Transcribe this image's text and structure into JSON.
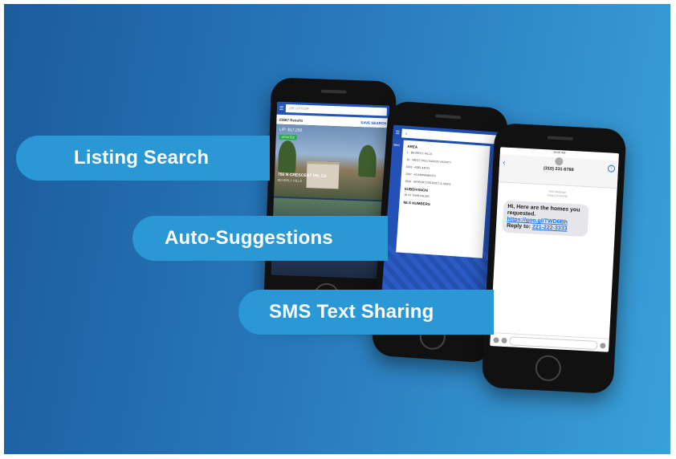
{
  "labels": {
    "listing_search": "Listing Search",
    "auto_suggestions": "Auto-Suggestions",
    "sms_text_sharing": "SMS Text Sharing"
  },
  "phone1": {
    "search_placeholder": "ZIP, CITY/ZIP",
    "results": "23687 Results",
    "save": "SAVE SEARCH",
    "price": "L/P: $17,250",
    "tag": "UPDATED",
    "address": "755 N CRESCENT DR, CA",
    "city": "BEVERLY HILLS"
  },
  "phone2": {
    "search_value": "1",
    "area_heading": "AREA",
    "area_items": [
      "1 - BEVERLY HILLS",
      "10 - WEST HOLLYWOOD VICINITY",
      "1003 - ADELANTO",
      "1007 - ACAMPAMENTO",
      "1009 - AIRPORT DISTRICT & OAKS"
    ],
    "subdivision_heading": "SUBDIVISION",
    "subdivision_items": [
      "1E AT TWIN PALMS"
    ],
    "mls_heading": "MLS NUMBERS",
    "side_label": "Bed"
  },
  "phone3": {
    "status_time": "10:00 AM",
    "phone_number": "(310) 231-6788",
    "meta_line1": "Text Message",
    "meta_line2": "Today 10:45 AM",
    "message_text": "Hi, Here are the homes you requested. ",
    "link1": "https://goo.gl/TWD6Bh",
    "reply_text": " Reply to: ",
    "link2": "221-222-3333"
  },
  "colors": {
    "pill": "#2a98d4",
    "background_start": "#1b5c9c",
    "background_end": "#3aa0d8"
  }
}
